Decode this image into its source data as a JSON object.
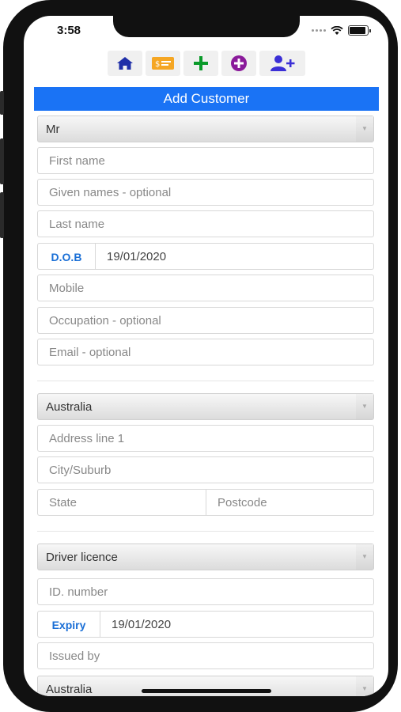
{
  "status": {
    "time": "3:58"
  },
  "toolbar": {
    "icons": [
      "home-icon",
      "payment-card-icon",
      "plus-icon",
      "add-circle-icon",
      "add-user-icon"
    ]
  },
  "colors": {
    "header": "#1a73f5",
    "label": "#1a6fd6",
    "home": "#1f2fa8",
    "card": "#f5a623",
    "plus": "#0a9a2a",
    "circle": "#8a1a9a",
    "user": "#3b2fd6"
  },
  "form": {
    "title": "Add Customer",
    "salutation": "Mr",
    "first_name_placeholder": "First name",
    "given_names_placeholder": "Given names - optional",
    "last_name_placeholder": "Last name",
    "dob_label": "D.O.B",
    "dob_value": "19/01/2020",
    "mobile_placeholder": "Mobile",
    "occupation_placeholder": "Occupation - optional",
    "email_placeholder": "Email - optional",
    "country": "Australia",
    "address_placeholder": "Address line 1",
    "city_placeholder": "City/Suburb",
    "state_placeholder": "State",
    "postcode_placeholder": "Postcode",
    "id_type": "Driver licence",
    "id_number_placeholder": "ID. number",
    "expiry_label": "Expiry",
    "expiry_value": "19/01/2020",
    "issued_by_placeholder": "Issued by",
    "issuing_country": "Australia"
  }
}
